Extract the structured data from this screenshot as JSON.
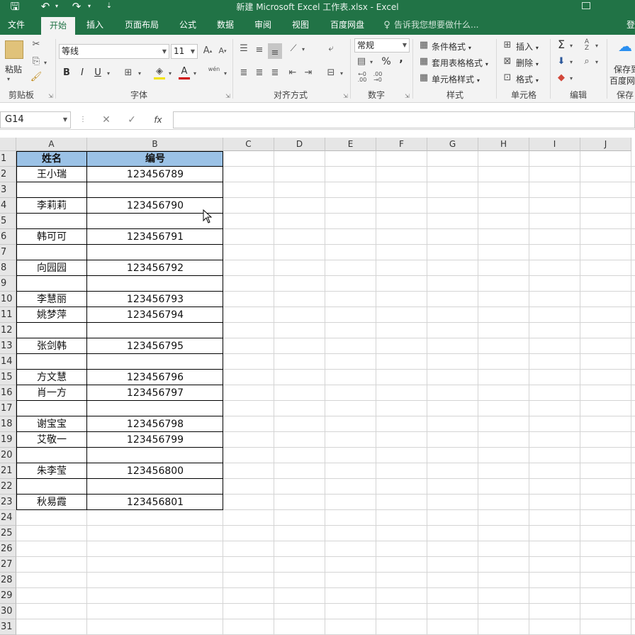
{
  "window": {
    "title": "新建 Microsoft Excel 工作表.xlsx - Excel"
  },
  "tabs": [
    {
      "label": "文件"
    },
    {
      "label": "开始"
    },
    {
      "label": "插入"
    },
    {
      "label": "页面布局"
    },
    {
      "label": "公式"
    },
    {
      "label": "数据"
    },
    {
      "label": "审阅"
    },
    {
      "label": "视图"
    },
    {
      "label": "百度网盘"
    },
    {
      "label": "告诉我您想要做什么..."
    },
    {
      "label": "登"
    }
  ],
  "ribbon": {
    "clipboard": {
      "paste": "粘贴",
      "label": "剪贴板"
    },
    "font": {
      "name": "等线",
      "size": "11",
      "label": "字体",
      "bold": "B",
      "italic": "I",
      "underline": "U",
      "color_a": "A",
      "wen": "wén"
    },
    "alignment": {
      "label": "对齐方式"
    },
    "number": {
      "format": "常规",
      "percent": "%",
      "comma": ",",
      "label": "数字"
    },
    "styles": {
      "conditional": "条件格式",
      "table": "套用表格格式",
      "cell": "单元格样式",
      "label": "样式"
    },
    "cells": {
      "insert": "插入",
      "delete": "删除",
      "format": "格式",
      "label": "单元格"
    },
    "editing": {
      "label": "编辑"
    },
    "save": {
      "line1": "保存到",
      "line2": "百度网",
      "label": "保存"
    }
  },
  "formula": {
    "namebox": "G14",
    "fx": "fx",
    "cancel": "✕",
    "confirm": "✓",
    "value": ""
  },
  "columns": [
    "A",
    "B",
    "C",
    "D",
    "E",
    "F",
    "G",
    "H",
    "I",
    "J"
  ],
  "rows": [
    "1",
    "2",
    "3",
    "4",
    "5",
    "6",
    "7",
    "8",
    "9",
    "10",
    "11",
    "12",
    "13",
    "14",
    "15",
    "16",
    "17",
    "18",
    "19",
    "20",
    "21",
    "22",
    "23",
    "24",
    "25",
    "26",
    "27",
    "28",
    "29",
    "30",
    "31"
  ],
  "sheet": {
    "header": [
      "姓名",
      "编号"
    ],
    "data": [
      [
        "王小瑞",
        "123456789"
      ],
      [
        "",
        ""
      ],
      [
        "李莉莉",
        "123456790"
      ],
      [
        "",
        ""
      ],
      [
        "韩可可",
        "123456791"
      ],
      [
        "",
        ""
      ],
      [
        "向园园",
        "123456792"
      ],
      [
        "",
        ""
      ],
      [
        "李慧丽",
        "123456793"
      ],
      [
        "姚梦萍",
        "123456794"
      ],
      [
        "",
        ""
      ],
      [
        "张剑韩",
        "123456795"
      ],
      [
        "",
        ""
      ],
      [
        "方文慧",
        "123456796"
      ],
      [
        "肖一方",
        "123456797"
      ],
      [
        "",
        ""
      ],
      [
        "谢宝宝",
        "123456798"
      ],
      [
        "艾敬一",
        "123456799"
      ],
      [
        "",
        ""
      ],
      [
        "朱李莹",
        "123456800"
      ],
      [
        "",
        ""
      ],
      [
        "秋易霞",
        "123456801"
      ]
    ]
  },
  "colors": {
    "excel_green": "#217346",
    "header_fill": "#9bc2e6"
  }
}
